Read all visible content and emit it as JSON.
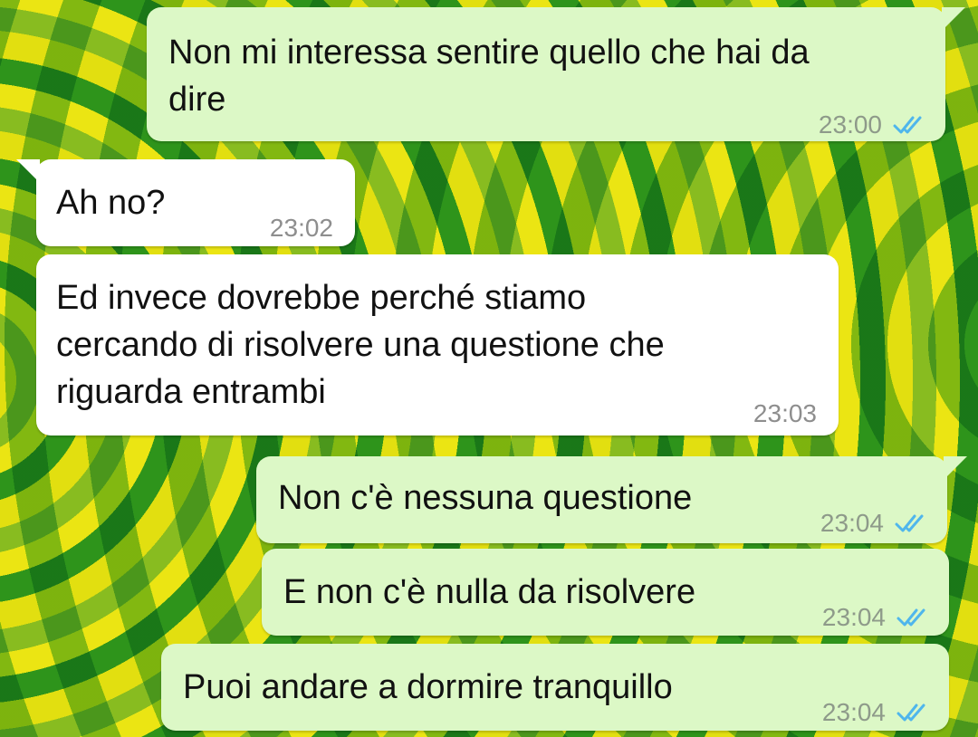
{
  "theme": {
    "outgoing_bubble": "#dcf8c6",
    "incoming_bubble": "#ffffff",
    "read_tick": "#4fb6ec",
    "timestamp": "#8e9a8a"
  },
  "messages": [
    {
      "direction": "outgoing",
      "text": "Non mi interessa sentire quello che hai da\ndire",
      "time": "23:00",
      "status": "read",
      "status_icon": "double-check-icon"
    },
    {
      "direction": "incoming",
      "text": "Ah no?",
      "time": "23:02"
    },
    {
      "direction": "incoming",
      "text": "Ed invece dovrebbe perché stiamo\ncercando di risolvere una questione che\nriguarda entrambi",
      "time": "23:03"
    },
    {
      "direction": "outgoing",
      "text": "Non c'è nessuna questione",
      "time": "23:04",
      "status": "read",
      "status_icon": "double-check-icon"
    },
    {
      "direction": "outgoing",
      "text": "E non c'è nulla da risolvere",
      "time": "23:04",
      "status": "read",
      "status_icon": "double-check-icon"
    },
    {
      "direction": "outgoing",
      "text": "Puoi andare a dormire tranquillo",
      "time": "23:04",
      "status": "read",
      "status_icon": "double-check-icon"
    }
  ]
}
